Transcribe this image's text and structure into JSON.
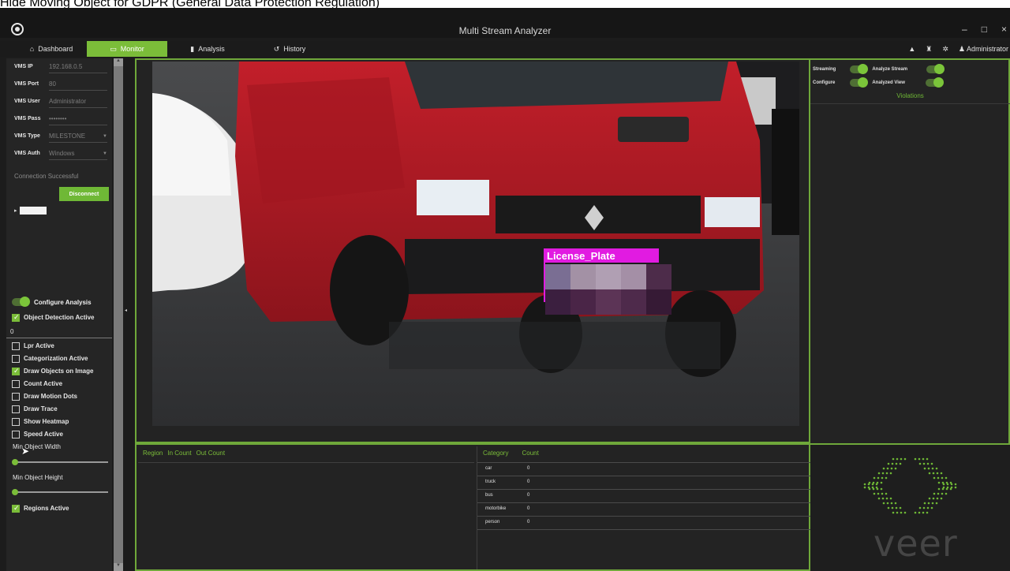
{
  "caption": "Hide Moving Object for GDPR (General Data Protection Regulation)",
  "window": {
    "title": "Multi Stream Analyzer",
    "controls": [
      "–",
      "□",
      "×"
    ]
  },
  "nav": {
    "tabs": [
      {
        "label": "Dashboard",
        "icon": "home-icon"
      },
      {
        "label": "Monitor",
        "icon": "monitor-icon",
        "active": true
      },
      {
        "label": "Analysis",
        "icon": "bar-chart-icon"
      },
      {
        "label": "History",
        "icon": "history-icon"
      }
    ],
    "user": "Administrator"
  },
  "vms": {
    "fields": [
      {
        "label": "VMS IP",
        "value": "192.168.0.5"
      },
      {
        "label": "VMS Port",
        "value": "80"
      },
      {
        "label": "VMS User",
        "value": "Administrator"
      },
      {
        "label": "VMS Pass",
        "value": "••••••••"
      },
      {
        "label": "VMS Type",
        "value": "MILESTONE",
        "dropdown": true
      },
      {
        "label": "VMS Auth",
        "value": "Windows",
        "dropdown": true
      }
    ],
    "connection_status": "Connection Successful",
    "disconnect_label": "Disconnect"
  },
  "analysis": {
    "configure_label": "Configure Analysis",
    "object_detection_label": "Object Detection Active",
    "object_detection_checked": true,
    "zero_value": "0",
    "options": [
      {
        "label": "Lpr Active",
        "checked": false
      },
      {
        "label": "Categorization Active",
        "checked": false
      },
      {
        "label": "Draw Objects on Image",
        "checked": true
      },
      {
        "label": "Count Active",
        "checked": false
      },
      {
        "label": "Draw Motion Dots",
        "checked": false
      },
      {
        "label": "Draw Trace",
        "checked": false
      },
      {
        "label": "Show Heatmap",
        "checked": false
      },
      {
        "label": "Speed Active",
        "checked": false
      }
    ],
    "min_width_label": "Min Object Width",
    "min_height_label": "Min Object Height",
    "regions_label": "Regions Active",
    "regions_checked": true
  },
  "stream": {
    "detection_label": "License_Plate",
    "accent": "#7bbd39",
    "detection_color": "#e11be1"
  },
  "right_panel": {
    "streaming_label": "Streaming",
    "configure_label": "Configure",
    "analyze_stream_label": "Analyze Stream",
    "analyzed_view_label": "Analyzed View",
    "violations_label": "Violations"
  },
  "region_table": {
    "headers": [
      "Region",
      "In Count",
      "Out Count"
    ]
  },
  "category_table": {
    "headers": [
      "Category",
      "Count"
    ],
    "rows": [
      {
        "name": "car",
        "count": "0"
      },
      {
        "name": "truck",
        "count": "0"
      },
      {
        "name": "bus",
        "count": "0"
      },
      {
        "name": "motorbike",
        "count": "0"
      },
      {
        "name": "person",
        "count": "0"
      }
    ]
  },
  "brand": {
    "name": "veer"
  }
}
